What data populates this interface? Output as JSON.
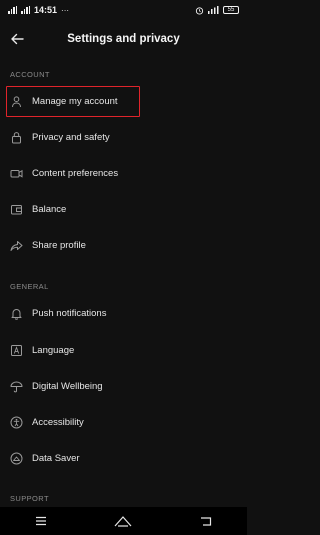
{
  "status_bar": {
    "time": "14:51",
    "extra": "···",
    "battery": "55"
  },
  "header": {
    "title": "Settings and privacy"
  },
  "sections": {
    "account": {
      "label": "ACCOUNT",
      "items": [
        {
          "label": "Manage my account",
          "icon": "person-icon"
        },
        {
          "label": "Privacy and safety",
          "icon": "lock-icon"
        },
        {
          "label": "Content preferences",
          "icon": "video-icon"
        },
        {
          "label": "Balance",
          "icon": "wallet-icon"
        },
        {
          "label": "Share profile",
          "icon": "share-icon"
        }
      ]
    },
    "general": {
      "label": "GENERAL",
      "items": [
        {
          "label": "Push notifications",
          "icon": "bell-icon"
        },
        {
          "label": "Language",
          "icon": "language-icon"
        },
        {
          "label": "Digital Wellbeing",
          "icon": "umbrella-icon"
        },
        {
          "label": "Accessibility",
          "icon": "accessibility-icon"
        },
        {
          "label": "Data Saver",
          "icon": "data-saver-icon"
        }
      ]
    },
    "support": {
      "label": "SUPPORT"
    }
  },
  "nav_bar": {
    "buttons": [
      "menu-icon",
      "home-icon",
      "back-icon"
    ]
  },
  "colors": {
    "background": "#111111",
    "highlight": "#e0242b",
    "section": "#8a8a8a"
  }
}
